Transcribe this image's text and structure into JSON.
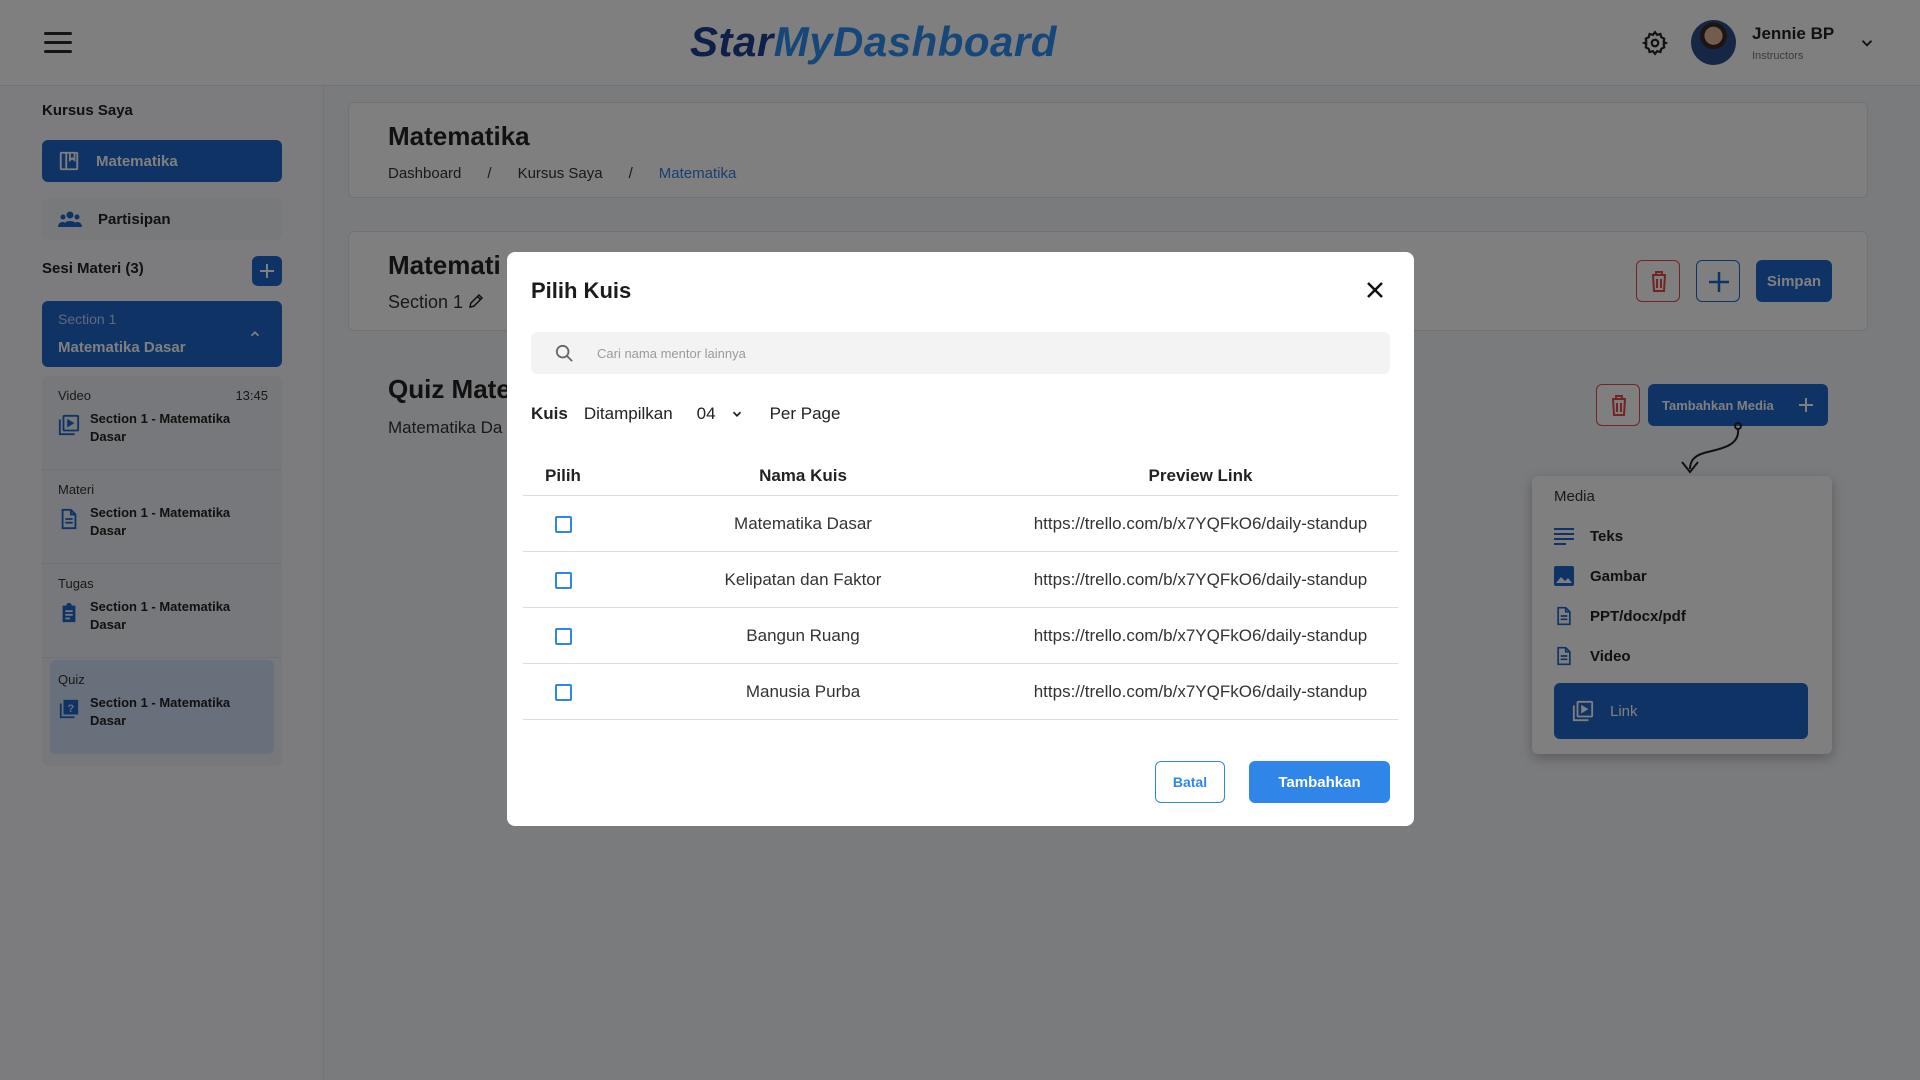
{
  "header": {
    "logo_part1": "Star",
    "logo_part2": "MyDashboard",
    "user_name": "Jennie BP",
    "user_role": "Instructors"
  },
  "sidebar": {
    "title": "Kursus Saya",
    "nav": [
      {
        "label": "Matematika"
      },
      {
        "label": "Partisipan"
      }
    ],
    "sesi_title": "Sesi Materi (3)",
    "section": {
      "label": "Section 1",
      "name": "Matematika Dasar"
    },
    "items": [
      {
        "category": "Video",
        "time": "13:45",
        "title": "Section 1 - Matematika Dasar"
      },
      {
        "category": "Materi",
        "title": "Section 1 - Matematika Dasar"
      },
      {
        "category": "Tugas",
        "title": "Section 1 - Matematika Dasar"
      },
      {
        "category": "Quiz",
        "title": "Section 1 - Matematika Dasar"
      }
    ]
  },
  "main": {
    "page_title": "Matematika",
    "breadcrumb": [
      "Dashboard",
      "/",
      "Kursus Saya",
      "/",
      "Matematika"
    ],
    "card_title": "Matemati",
    "section_label": "Section 1",
    "save_label": "Simpan",
    "quiz_title": "Quiz Mate",
    "quiz_sub": "Matematika Da",
    "add_media_label": "Tambahkan Media",
    "media_panel": {
      "title": "Media",
      "options": [
        "Teks",
        "Gambar",
        "PPT/docx/pdf",
        "Video"
      ],
      "link_label": "Link"
    }
  },
  "modal": {
    "title": "Pilih Kuis",
    "search_placeholder": "Cari nama mentor lainnya",
    "filter": {
      "label": "Kuis",
      "shown": "Ditampilkan",
      "value": "04",
      "per_page": "Per Page"
    },
    "columns": [
      "Pilih",
      "Nama Kuis",
      "Preview Link"
    ],
    "rows": [
      {
        "name": "Matematika Dasar",
        "link": "https://trello.com/b/x7YQFkO6/daily-standup",
        "checked": false
      },
      {
        "name": "Kelipatan dan Faktor",
        "link": "https://trello.com/b/x7YQFkO6/daily-standup",
        "checked": false
      },
      {
        "name": "Bangun Ruang",
        "link": "https://trello.com/b/x7YQFkO6/daily-standup",
        "checked": false
      },
      {
        "name": "Manusia Purba",
        "link": "https://trello.com/b/x7YQFkO6/daily-standup",
        "checked": false
      }
    ],
    "cancel_label": "Batal",
    "submit_label": "Tambahkan"
  },
  "colors": {
    "primary": "#1f67c9",
    "accent": "#2f86e8",
    "danger": "#e24b4b",
    "overlay": "rgba(0,0,0,0.5)"
  }
}
